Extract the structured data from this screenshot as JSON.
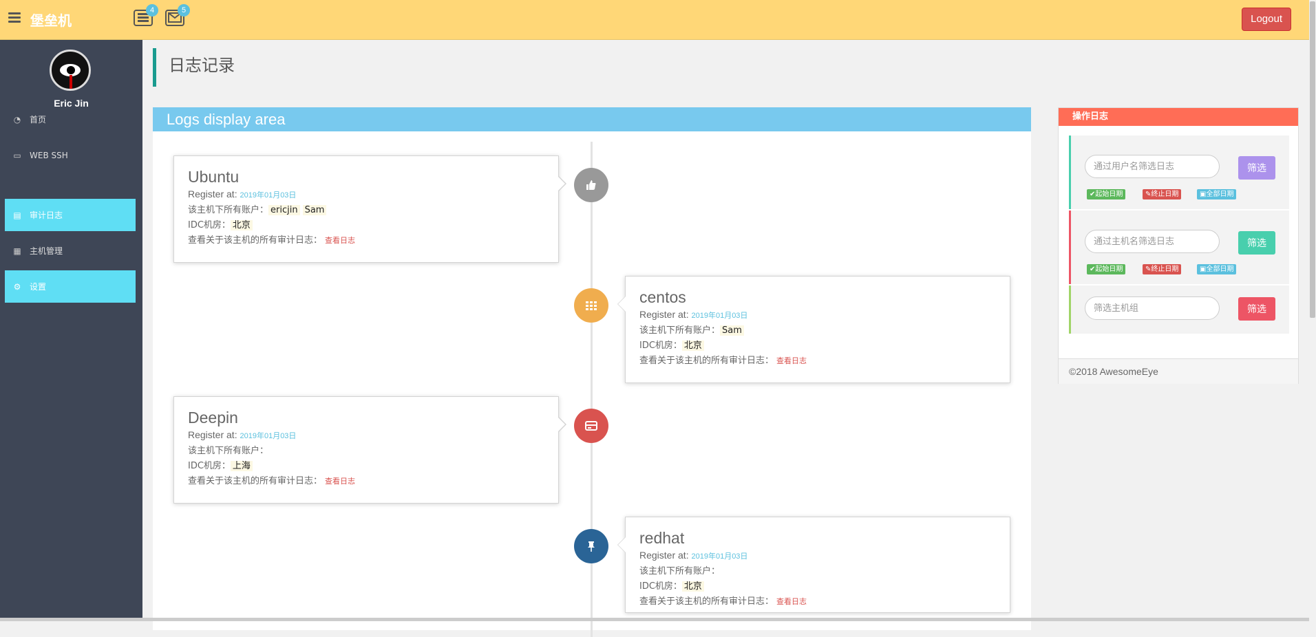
{
  "header": {
    "brand": "堡垒机",
    "badge1": "4",
    "badge2": "5",
    "logout": "Logout"
  },
  "sidebar": {
    "username": "Eric Jin",
    "items": [
      {
        "label": "首页",
        "icon": "dashboard-icon"
      },
      {
        "label": "WEB SSH",
        "icon": "desktop-icon"
      },
      {
        "label": "审计日志",
        "icon": "book-icon"
      },
      {
        "label": "主机管理",
        "icon": "grid-icon"
      },
      {
        "label": "设置",
        "icon": "cogs-icon"
      }
    ]
  },
  "page": {
    "title": "日志记录"
  },
  "logs": {
    "title": "Logs display area",
    "register_label": "Register at:",
    "accounts_label": "该主机下所有账户：",
    "idc_label": "IDC机房：",
    "audit_label": "查看关于该主机的所有审计日志：",
    "view_link": "查看日志",
    "hosts": [
      {
        "name": "Ubuntu",
        "date": "2019年01月03日",
        "users": [
          "ericjin",
          "Sam"
        ],
        "idc": "北京",
        "badge_color": "#999999"
      },
      {
        "name": "centos",
        "date": "2019年01月03日",
        "users": [
          "Sam"
        ],
        "idc": "北京",
        "badge_color": "#f0ad4e"
      },
      {
        "name": "Deepin",
        "date": "2019年01月03日",
        "users": [],
        "idc": "上海",
        "badge_color": "#d9534f"
      },
      {
        "name": "redhat",
        "date": "2019年01月03日",
        "users": [],
        "idc": "北京",
        "badge_color": "#2a6496"
      }
    ]
  },
  "ops": {
    "title": "操作日志",
    "user_placeholder": "通过用户名筛选日志",
    "host_placeholder": "通过主机名筛选日志",
    "group_placeholder": "筛选主机组",
    "filter_btn": "筛选",
    "start_date": "起始日期",
    "end_date": "终止日期",
    "all_dates": "全部日期",
    "footer": "©2018 AwesomeEye"
  },
  "colors": {
    "header_bg": "#ffd777",
    "sidebar_bg": "#3e4656",
    "nav_active": "#5fdef4",
    "logs_head": "#78c9ee",
    "ops_head": "#ff6d56",
    "logout": "#d9534f"
  }
}
